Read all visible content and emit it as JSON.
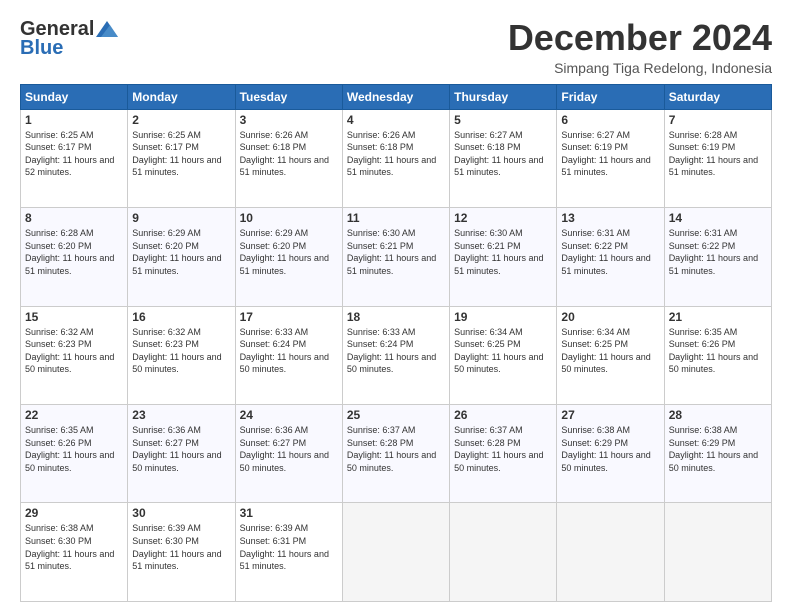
{
  "header": {
    "logo_general": "General",
    "logo_blue": "Blue",
    "month_title": "December 2024",
    "subtitle": "Simpang Tiga Redelong, Indonesia"
  },
  "days_of_week": [
    "Sunday",
    "Monday",
    "Tuesday",
    "Wednesday",
    "Thursday",
    "Friday",
    "Saturday"
  ],
  "weeks": [
    [
      {
        "num": "1",
        "sunrise": "6:25 AM",
        "sunset": "6:17 PM",
        "daylight": "11 hours and 52 minutes."
      },
      {
        "num": "2",
        "sunrise": "6:25 AM",
        "sunset": "6:17 PM",
        "daylight": "11 hours and 51 minutes."
      },
      {
        "num": "3",
        "sunrise": "6:26 AM",
        "sunset": "6:18 PM",
        "daylight": "11 hours and 51 minutes."
      },
      {
        "num": "4",
        "sunrise": "6:26 AM",
        "sunset": "6:18 PM",
        "daylight": "11 hours and 51 minutes."
      },
      {
        "num": "5",
        "sunrise": "6:27 AM",
        "sunset": "6:18 PM",
        "daylight": "11 hours and 51 minutes."
      },
      {
        "num": "6",
        "sunrise": "6:27 AM",
        "sunset": "6:19 PM",
        "daylight": "11 hours and 51 minutes."
      },
      {
        "num": "7",
        "sunrise": "6:28 AM",
        "sunset": "6:19 PM",
        "daylight": "11 hours and 51 minutes."
      }
    ],
    [
      {
        "num": "8",
        "sunrise": "6:28 AM",
        "sunset": "6:20 PM",
        "daylight": "11 hours and 51 minutes."
      },
      {
        "num": "9",
        "sunrise": "6:29 AM",
        "sunset": "6:20 PM",
        "daylight": "11 hours and 51 minutes."
      },
      {
        "num": "10",
        "sunrise": "6:29 AM",
        "sunset": "6:20 PM",
        "daylight": "11 hours and 51 minutes."
      },
      {
        "num": "11",
        "sunrise": "6:30 AM",
        "sunset": "6:21 PM",
        "daylight": "11 hours and 51 minutes."
      },
      {
        "num": "12",
        "sunrise": "6:30 AM",
        "sunset": "6:21 PM",
        "daylight": "11 hours and 51 minutes."
      },
      {
        "num": "13",
        "sunrise": "6:31 AM",
        "sunset": "6:22 PM",
        "daylight": "11 hours and 51 minutes."
      },
      {
        "num": "14",
        "sunrise": "6:31 AM",
        "sunset": "6:22 PM",
        "daylight": "11 hours and 51 minutes."
      }
    ],
    [
      {
        "num": "15",
        "sunrise": "6:32 AM",
        "sunset": "6:23 PM",
        "daylight": "11 hours and 50 minutes."
      },
      {
        "num": "16",
        "sunrise": "6:32 AM",
        "sunset": "6:23 PM",
        "daylight": "11 hours and 50 minutes."
      },
      {
        "num": "17",
        "sunrise": "6:33 AM",
        "sunset": "6:24 PM",
        "daylight": "11 hours and 50 minutes."
      },
      {
        "num": "18",
        "sunrise": "6:33 AM",
        "sunset": "6:24 PM",
        "daylight": "11 hours and 50 minutes."
      },
      {
        "num": "19",
        "sunrise": "6:34 AM",
        "sunset": "6:25 PM",
        "daylight": "11 hours and 50 minutes."
      },
      {
        "num": "20",
        "sunrise": "6:34 AM",
        "sunset": "6:25 PM",
        "daylight": "11 hours and 50 minutes."
      },
      {
        "num": "21",
        "sunrise": "6:35 AM",
        "sunset": "6:26 PM",
        "daylight": "11 hours and 50 minutes."
      }
    ],
    [
      {
        "num": "22",
        "sunrise": "6:35 AM",
        "sunset": "6:26 PM",
        "daylight": "11 hours and 50 minutes."
      },
      {
        "num": "23",
        "sunrise": "6:36 AM",
        "sunset": "6:27 PM",
        "daylight": "11 hours and 50 minutes."
      },
      {
        "num": "24",
        "sunrise": "6:36 AM",
        "sunset": "6:27 PM",
        "daylight": "11 hours and 50 minutes."
      },
      {
        "num": "25",
        "sunrise": "6:37 AM",
        "sunset": "6:28 PM",
        "daylight": "11 hours and 50 minutes."
      },
      {
        "num": "26",
        "sunrise": "6:37 AM",
        "sunset": "6:28 PM",
        "daylight": "11 hours and 50 minutes."
      },
      {
        "num": "27",
        "sunrise": "6:38 AM",
        "sunset": "6:29 PM",
        "daylight": "11 hours and 50 minutes."
      },
      {
        "num": "28",
        "sunrise": "6:38 AM",
        "sunset": "6:29 PM",
        "daylight": "11 hours and 50 minutes."
      }
    ],
    [
      {
        "num": "29",
        "sunrise": "6:38 AM",
        "sunset": "6:30 PM",
        "daylight": "11 hours and 51 minutes."
      },
      {
        "num": "30",
        "sunrise": "6:39 AM",
        "sunset": "6:30 PM",
        "daylight": "11 hours and 51 minutes."
      },
      {
        "num": "31",
        "sunrise": "6:39 AM",
        "sunset": "6:31 PM",
        "daylight": "11 hours and 51 minutes."
      },
      null,
      null,
      null,
      null
    ]
  ]
}
